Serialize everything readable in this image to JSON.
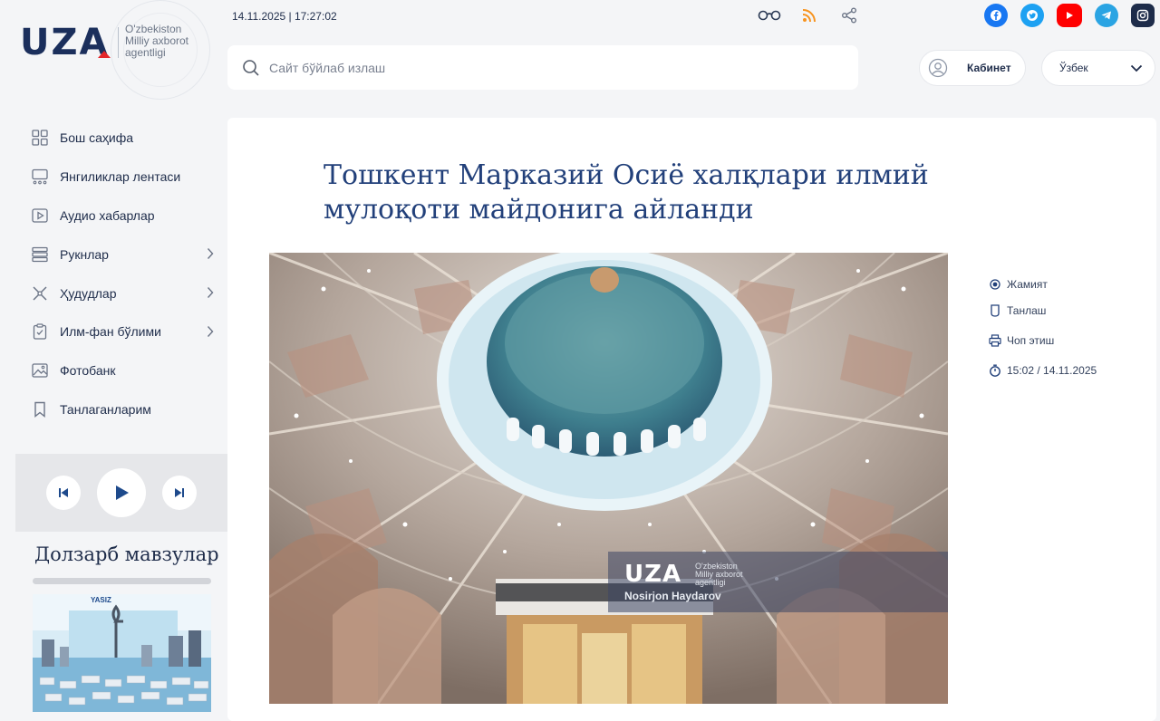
{
  "brand": {
    "logo_text": "UZA",
    "tagline_1": "O'zbekiston",
    "tagline_2": "Milliy axborot",
    "tagline_3": "agentligi"
  },
  "header": {
    "datetime": "14.11.2025 | 17:27:02",
    "top_icons": [
      "glasses-icon",
      "rss-icon",
      "share-icon"
    ],
    "social": [
      {
        "name": "facebook-icon",
        "color": "#1877f2"
      },
      {
        "name": "twitter-icon",
        "color": "#1da1f2"
      },
      {
        "name": "youtube-icon",
        "color": "#ff0000"
      },
      {
        "name": "telegram-icon",
        "color": "#2aa4e3"
      },
      {
        "name": "instagram-icon",
        "color": "#1e2c4a"
      }
    ],
    "search_placeholder": "Сайт бўйлаб излаш",
    "cabinet_label": "Кабинет",
    "language": "Ўзбек"
  },
  "sidebar": {
    "items": [
      {
        "label": "Бош саҳифа",
        "icon": "grid-icon",
        "has_submenu": false
      },
      {
        "label": "Янгиликлар лентаси",
        "icon": "news-feed-icon",
        "has_submenu": false
      },
      {
        "label": "Аудио хабарлар",
        "icon": "play-box-icon",
        "has_submenu": false
      },
      {
        "label": "Рукнлар",
        "icon": "stack-icon",
        "has_submenu": true
      },
      {
        "label": "Ҳудудлар",
        "icon": "regions-icon",
        "has_submenu": true
      },
      {
        "label": "Илм-фан бўлими",
        "icon": "clipboard-icon",
        "has_submenu": true
      },
      {
        "label": "Фотобанк",
        "icon": "image-icon",
        "has_submenu": false
      },
      {
        "label": "Танлаганларим",
        "icon": "bookmark-icon",
        "has_submenu": false
      }
    ]
  },
  "player": {
    "controls": [
      "previous-icon",
      "play-icon",
      "next-icon"
    ]
  },
  "topics": {
    "title": "Долзарб мавзулар",
    "card_label": "YASIZ"
  },
  "article": {
    "title": "Тошкент Марказий Осиё халқлари илмий мулоқоти майдонига айланди",
    "photo_watermark": "UZA",
    "photo_watermark_sub_1": "O'zbekiston",
    "photo_watermark_sub_2": "Milliy axborot",
    "photo_watermark_sub_3": "agentligi",
    "photo_author": "Nosirjon Haydarov",
    "meta": {
      "category": "Жамият",
      "favorite": "Танлаш",
      "print": "Чоп этиш",
      "published": "15:02 / 14.11.2025"
    }
  },
  "colors": {
    "accent": "#22407a",
    "logo_red": "#e4262a",
    "rss_orange": "#f7931e"
  }
}
